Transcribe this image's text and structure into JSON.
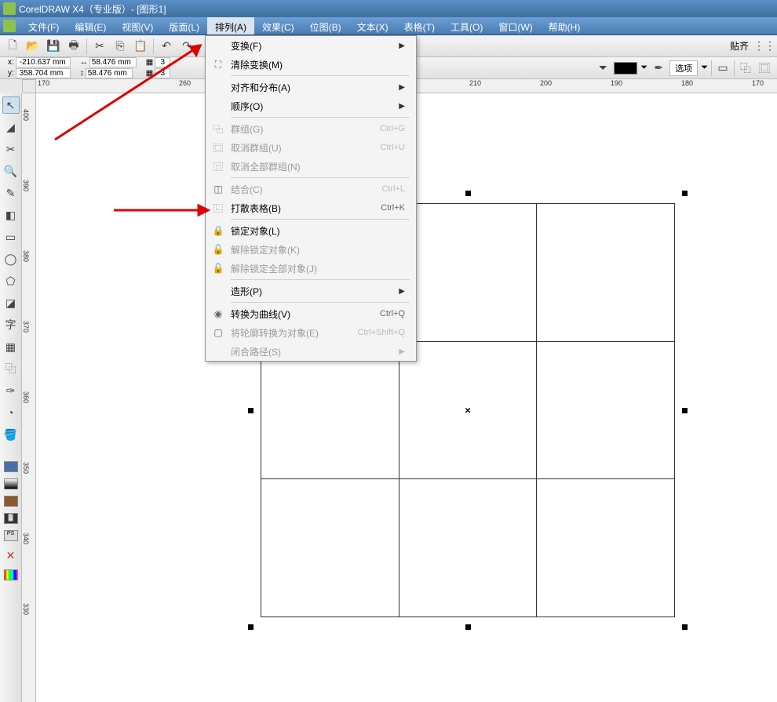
{
  "title": "CorelDRAW X4（专业版）- [图形1]",
  "menu": {
    "file": "文件(F)",
    "edit": "编辑(E)",
    "view": "视图(V)",
    "layout": "版面(L)",
    "arrange": "排列(A)",
    "effects": "效果(C)",
    "bitmap": "位图(B)",
    "text": "文本(X)",
    "table": "表格(T)",
    "tools": "工具(O)",
    "window": "窗口(W)",
    "help": "帮助(H)"
  },
  "toolbar_right": {
    "snap": "贴齐",
    "options": "选项"
  },
  "coords": {
    "x_label": "x:",
    "x_val": "-210.637 mm",
    "y_label": "y:",
    "y_val": "358.704 mm",
    "w_val": "58.476 mm",
    "h_val": "58.476 mm",
    "col_val": "3",
    "row_val": "3"
  },
  "ruler_h": [
    "170",
    "260",
    "210",
    "200",
    "190",
    "180",
    "170"
  ],
  "ruler_v": [
    "400",
    "390",
    "380",
    "370",
    "360",
    "350",
    "340",
    "330"
  ],
  "dropdown": {
    "transform": "变换(F)",
    "clear_transform": "清除变换(M)",
    "align": "对齐和分布(A)",
    "order": "顺序(O)",
    "group": "群组(G)",
    "group_sc": "Ctrl+G",
    "ungroup": "取消群组(U)",
    "ungroup_sc": "Ctrl+U",
    "ungroup_all": "取消全部群组(N)",
    "combine": "结合(C)",
    "combine_sc": "Ctrl+L",
    "break": "打散表格(B)",
    "break_sc": "Ctrl+K",
    "lock": "锁定对象(L)",
    "unlock": "解除锁定对象(K)",
    "unlock_all": "解除锁定全部对象(J)",
    "shaping": "造形(P)",
    "to_curve": "转换为曲线(V)",
    "to_curve_sc": "Ctrl+Q",
    "outline_obj": "将轮廓转换为对象(E)",
    "outline_sc": "Ctrl+Shift+Q",
    "close_path": "闭合路径(S)"
  }
}
